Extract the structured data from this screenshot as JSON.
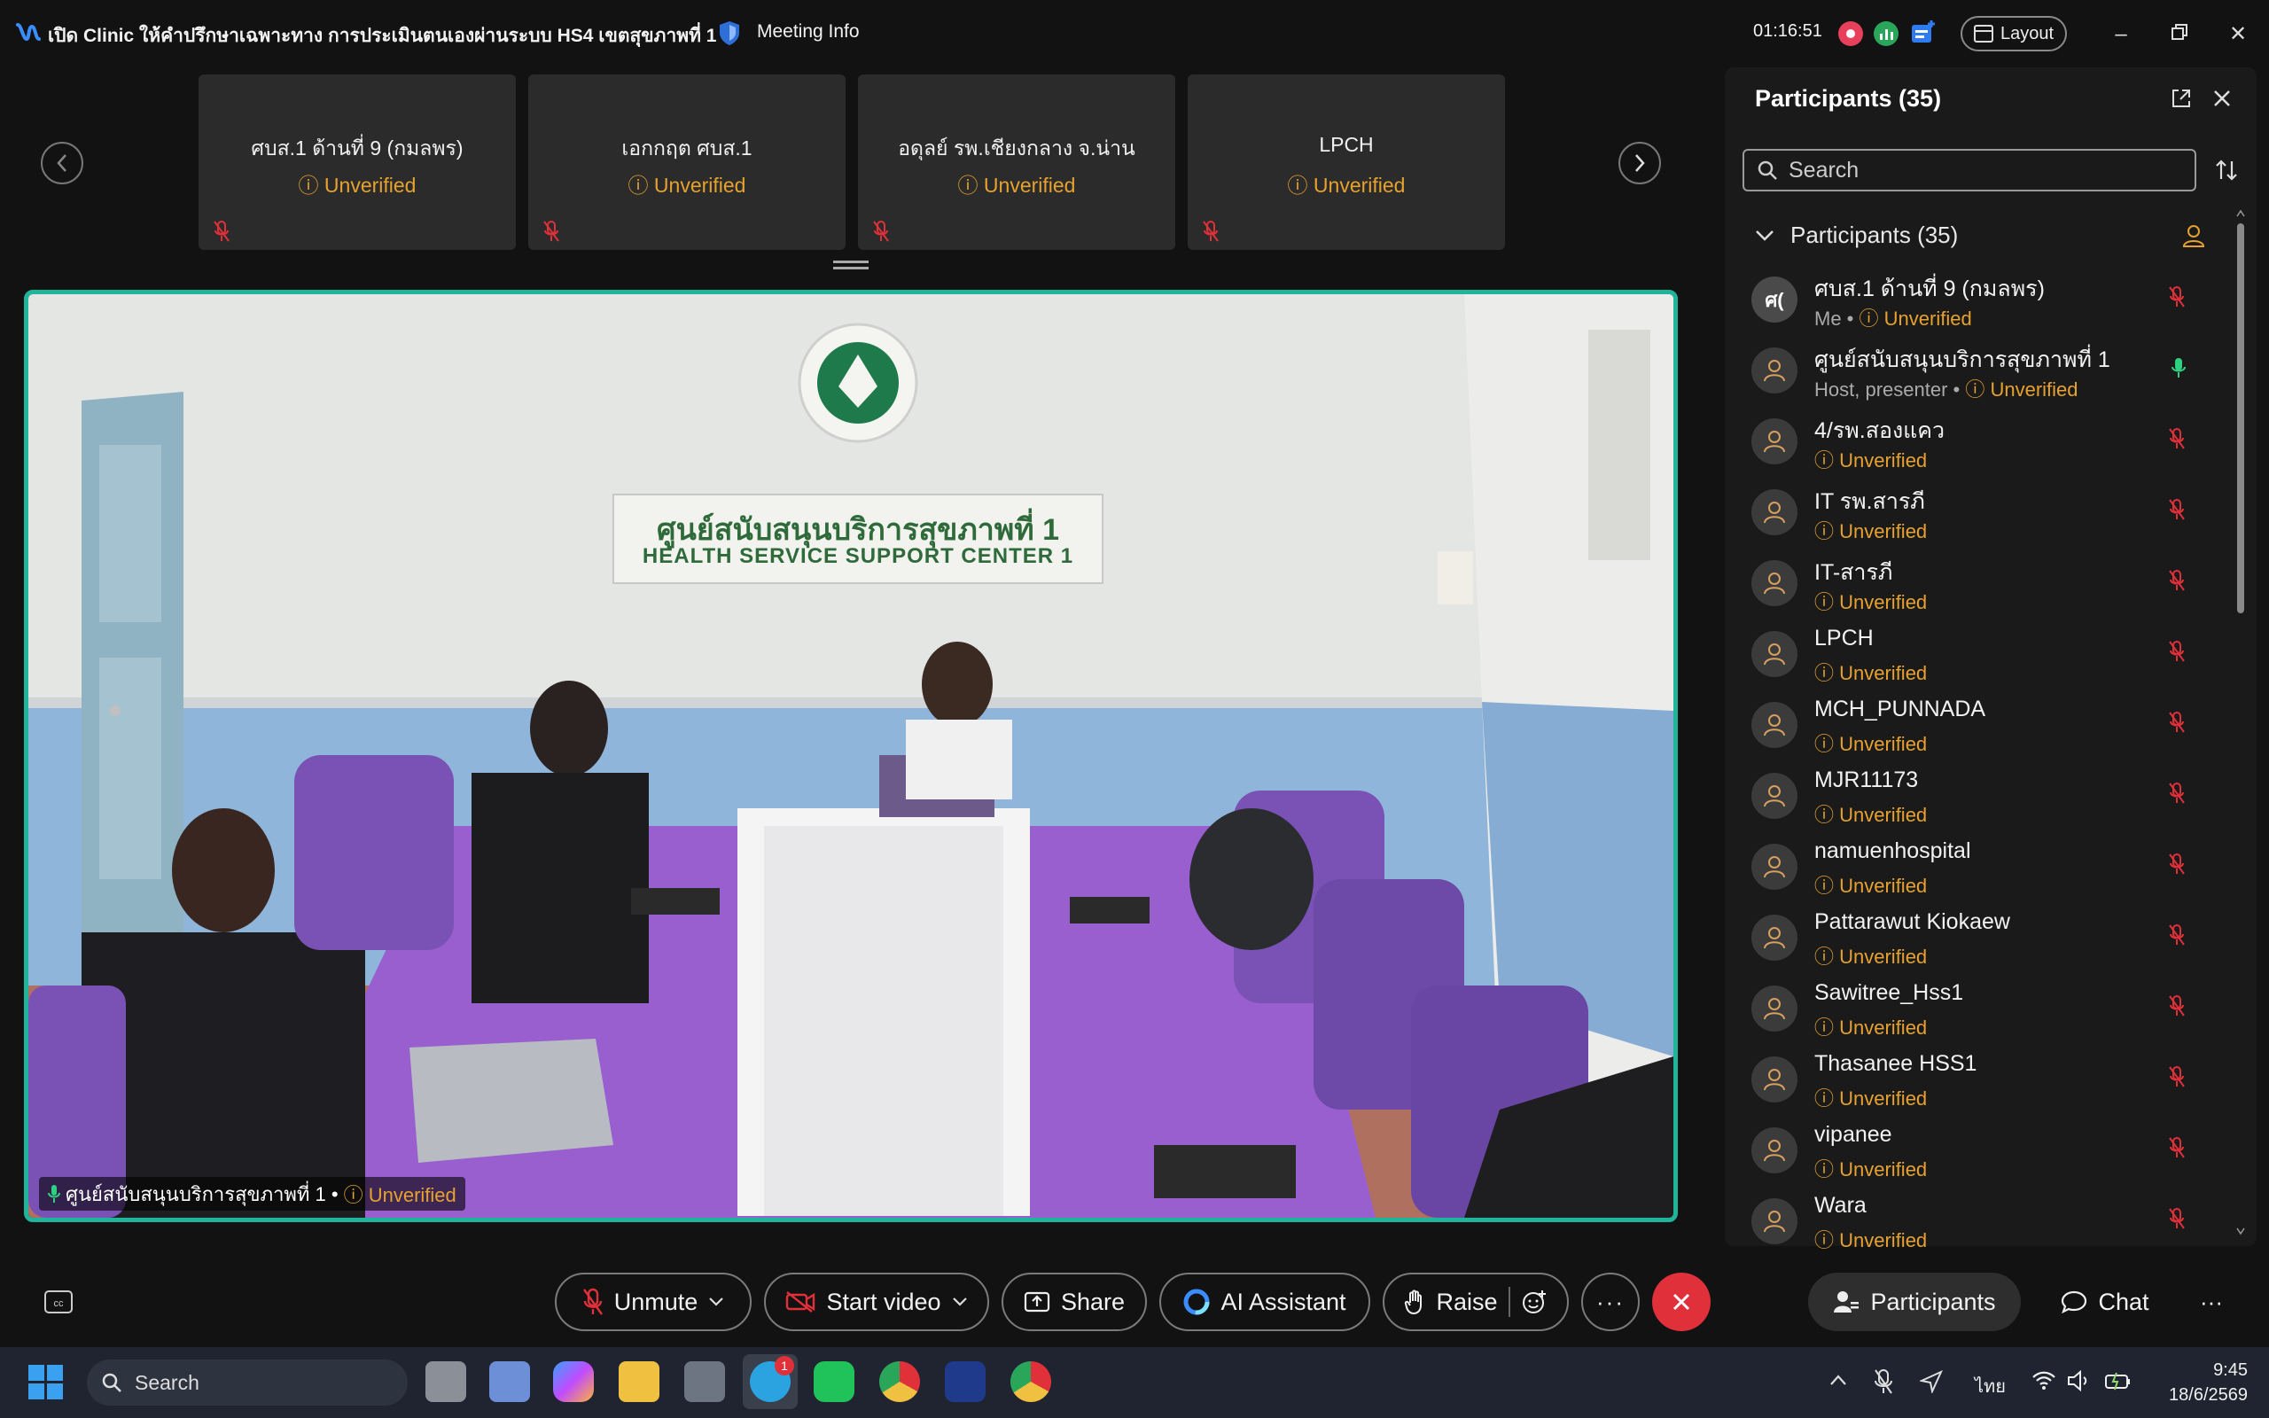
{
  "titlebar": {
    "meeting_title": "เปิด Clinic ให้คำปรึกษาเฉพาะทาง การประเมินตนเองผ่านระบบ HS4 เขตสุขภาพที่ 1",
    "meeting_info": "Meeting Info",
    "timer": "01:16:51",
    "layout_label": "Layout"
  },
  "filmstrip": [
    {
      "name": "ศบส.1 ด้านที่ 9 (กมลพร)",
      "status": "Unverified"
    },
    {
      "name": "เอกกฤต ศบส.1",
      "status": "Unverified"
    },
    {
      "name": "อดุลย์ รพ.เชียงกลาง จ.น่าน",
      "status": "Unverified"
    },
    {
      "name": "LPCH",
      "status": "Unverified"
    }
  ],
  "video": {
    "sign_line1": "ศูนย์สนับสนุนบริการสุขภาพที่ 1",
    "sign_line2": "HEALTH SERVICE SUPPORT CENTER 1",
    "label_name": "ศูนย์สนับสนุนบริการสุขภาพที่ 1 •",
    "label_status": "Unverified"
  },
  "panel": {
    "title": "Participants (35)",
    "search_placeholder": "Search",
    "section_label": "Participants (35)",
    "participants": [
      {
        "name": "ศบส.1 ด้านที่ 9 (กมลพร)",
        "role": "Me •",
        "status": "Unverified",
        "avatar": "ศ(",
        "mic": "muted"
      },
      {
        "name": "ศูนย์สนับสนุนบริการสุขภาพที่ 1",
        "role": "Host, presenter •",
        "status": "Unverified",
        "avatar": "",
        "mic": "on"
      },
      {
        "name": "4/รพ.สองแคว",
        "role": "",
        "status": "Unverified",
        "avatar": "",
        "mic": "muted"
      },
      {
        "name": "IT รพ.สารภี",
        "role": "",
        "status": "Unverified",
        "avatar": "",
        "mic": "muted"
      },
      {
        "name": "IT-สารภี",
        "role": "",
        "status": "Unverified",
        "avatar": "",
        "mic": "muted"
      },
      {
        "name": "LPCH",
        "role": "",
        "status": "Unverified",
        "avatar": "",
        "mic": "muted"
      },
      {
        "name": "MCH_PUNNADA",
        "role": "",
        "status": "Unverified",
        "avatar": "",
        "mic": "muted"
      },
      {
        "name": "MJR11173",
        "role": "",
        "status": "Unverified",
        "avatar": "",
        "mic": "muted"
      },
      {
        "name": "namuenhospital",
        "role": "",
        "status": "Unverified",
        "avatar": "",
        "mic": "muted"
      },
      {
        "name": "Pattarawut Kiokaew",
        "role": "",
        "status": "Unverified",
        "avatar": "",
        "mic": "muted"
      },
      {
        "name": "Sawitree_Hss1",
        "role": "",
        "status": "Unverified",
        "avatar": "",
        "mic": "muted"
      },
      {
        "name": "Thasanee  HSS1",
        "role": "",
        "status": "Unverified",
        "avatar": "",
        "mic": "muted"
      },
      {
        "name": "vipanee",
        "role": "",
        "status": "Unverified",
        "avatar": "",
        "mic": "muted"
      },
      {
        "name": "Wara",
        "role": "",
        "status": "Unverified",
        "avatar": "",
        "mic": "muted"
      }
    ]
  },
  "controls": {
    "unmute": "Unmute",
    "start_video": "Start video",
    "share": "Share",
    "ai_assistant": "AI Assistant",
    "raise": "Raise",
    "participants": "Participants",
    "chat": "Chat"
  },
  "taskbar": {
    "search": "Search",
    "telegram_badge": "1",
    "lang": "ไทย",
    "time": "9:45",
    "date": "18/6/2569"
  },
  "colors": {
    "accent_teal": "#1fb59c",
    "unverified": "#e6a22e",
    "muted_red": "#e0303a",
    "panel_bg": "#1a1a1a"
  }
}
